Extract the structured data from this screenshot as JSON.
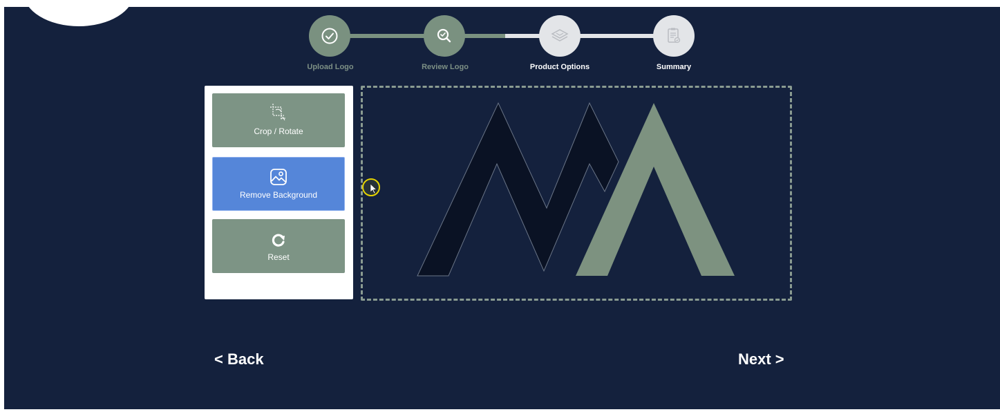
{
  "steps": [
    {
      "label": "Upload Logo",
      "status": "done",
      "icon": "check-icon"
    },
    {
      "label": "Review Logo",
      "status": "done",
      "icon": "magnifier-icon"
    },
    {
      "label": "Product Options",
      "status": "todo",
      "icon": "layers-icon"
    },
    {
      "label": "Summary",
      "status": "todo",
      "icon": "clipboard-icon"
    }
  ],
  "tools": [
    {
      "label": "Crop / Rotate",
      "icon": "crop-icon",
      "active": false
    },
    {
      "label": "Remove Background",
      "icon": "image-icon",
      "active": true
    },
    {
      "label": "Reset",
      "icon": "refresh-icon",
      "active": false
    }
  ],
  "nav": {
    "back_label": "< Back",
    "next_label": "Next >"
  },
  "colors": {
    "background": "#14213d",
    "accent_green": "#7d9485",
    "active_blue": "#5586d9",
    "logo_dark": "#0a1224",
    "logo_green": "#7d9280"
  }
}
